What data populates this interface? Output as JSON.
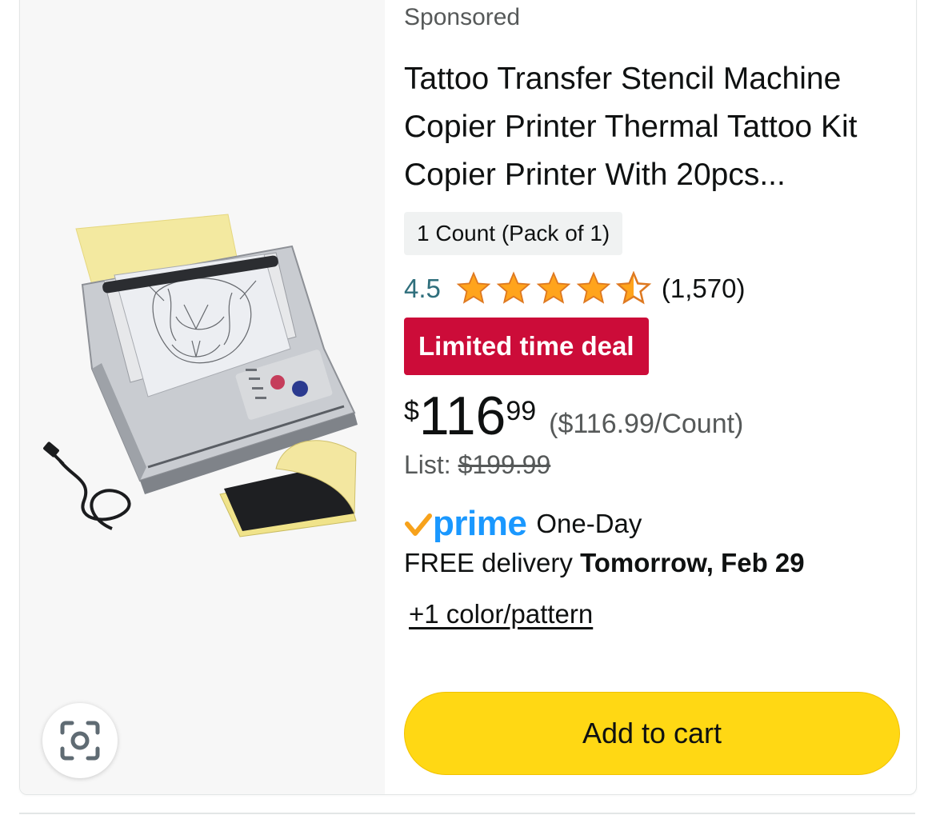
{
  "listing": {
    "sponsored_label": "Sponsored",
    "title": "Tattoo Transfer Stencil Machine Copier Printer Thermal Tattoo Kit Copier Printer With 20pcs...",
    "variant": "1 Count (Pack of 1)",
    "rating": {
      "value": "4.5",
      "stars_out_of_5": 4.5,
      "count": "(1,570)"
    },
    "deal_badge": "Limited time deal",
    "price": {
      "symbol": "$",
      "whole": "116",
      "fraction": "99",
      "unit_price": "($116.99/Count)"
    },
    "list_price": {
      "label": "List:",
      "value": "$199.99"
    },
    "prime": {
      "logo_text": "prime",
      "speed": "One-Day"
    },
    "delivery": {
      "prefix": "FREE delivery",
      "date": "Tomorrow, Feb 29"
    },
    "variations_link": "+1 color/pattern",
    "add_to_cart": "Add to cart"
  },
  "icons": {
    "lens": "camera-lens-icon",
    "star": "star-icon",
    "prime_check": "checkmark-icon"
  },
  "colors": {
    "deal_red": "#cc0c39",
    "add_to_cart_yellow": "#ffd814",
    "star_orange": "#ffa41c",
    "prime_blue": "#1a98ff",
    "rating_teal": "#2f6f7c"
  }
}
